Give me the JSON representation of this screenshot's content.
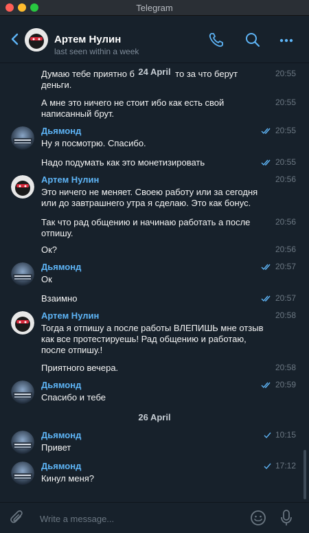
{
  "window": {
    "title": "Telegram"
  },
  "header": {
    "name": "Артем Нулин",
    "status": "last seen within a week",
    "icons": [
      "back-icon",
      "phone-icon",
      "search-icon",
      "more-icon"
    ]
  },
  "chat": {
    "floating_date": "24 April",
    "messages": [
      {
        "text": "Думаю тебе приятно б... бовать то за что берут деньги.",
        "time": "20:55"
      },
      {
        "text": "А мне это ничего не стоит ибо как есть свой написанный брут.",
        "time": "20:55"
      },
      {
        "sender": "Дьямонд",
        "text": "Ну я посмотрю. Спасибо.",
        "time": "20:55",
        "read": true
      },
      {
        "text": "Надо подумать как это монетизировать",
        "time": "20:55",
        "read": true
      },
      {
        "sender": "Артем Нулин",
        "text": "Это ничего не меняет. Своею работу или за сегодня или до завтрашнего утра я сделаю. Это как бонус.",
        "time": "20:56"
      },
      {
        "text": "Так что рад общению и начинаю работать а после отпишу.",
        "time": "20:56"
      },
      {
        "text": "Ок?",
        "time": "20:56"
      },
      {
        "sender": "Дьямонд",
        "text": "Ок",
        "time": "20:57",
        "read": true
      },
      {
        "text": "Взаимно",
        "time": "20:57",
        "read": true
      },
      {
        "sender": "Артем Нулин",
        "text": "Тогда я отпишу а после работы ВЛЕПИШЬ мне отзыв как все протестируешь! Рад общению и работаю, после отпишу.!",
        "time": "20:58"
      },
      {
        "text": "Приятного вечера.",
        "time": "20:58"
      },
      {
        "sender": "Дьямонд",
        "text": "Спасибо и тебе",
        "time": "20:59",
        "read": true
      },
      {
        "sender": "Дьямонд",
        "text": "Привет",
        "time": "10:15",
        "read": false
      },
      {
        "sender": "Дьямонд",
        "text": "Кинул меня?",
        "time": "17:12",
        "read": false
      }
    ],
    "date_separator": "26 April"
  },
  "composer": {
    "placeholder": "Write a message...",
    "icons": [
      "attach-icon",
      "emoji-icon",
      "microphone-icon"
    ]
  },
  "colors": {
    "background": "#17212b",
    "accent": "#5eb5f7",
    "time": "#6c7883",
    "check": "#5eb5f7"
  }
}
